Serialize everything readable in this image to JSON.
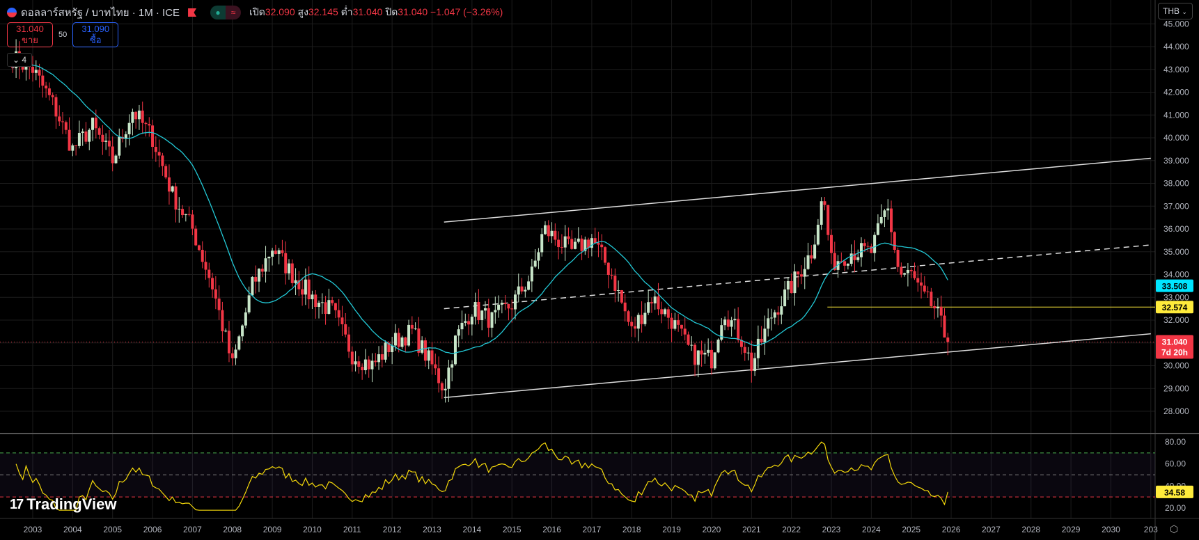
{
  "header": {
    "title": "ดอลลาร์สหรัฐ / บาทไทย · 1M · ICE",
    "open_label": "เปิด",
    "open": "32.090",
    "high_label": "สูง",
    "high": "32.145",
    "low_label": "ต่ำ",
    "low": "31.040",
    "close_label": "ปิด",
    "close": "31.040",
    "change": "−1.047 (−3.26%)",
    "pill_left": "●",
    "pill_right": "≈"
  },
  "trade": {
    "sell_price": "31.040",
    "sell_label": "ขาย",
    "qty": "50",
    "buy_price": "31.090",
    "buy_label": "ซื้อ"
  },
  "collapse_label": "4",
  "currency": "THB",
  "logo": "TradingView",
  "colors": {
    "up": "#c8e6c9",
    "down": "#f23645",
    "ma": "#22c9d6",
    "level": "#ffeb3b",
    "bg": "#000000",
    "grid": "#1c1c1c"
  },
  "chart_data": {
    "type": "candlestick",
    "price_ticks": [
      "45.000",
      "44.000",
      "43.000",
      "42.000",
      "41.000",
      "40.000",
      "39.000",
      "38.000",
      "37.000",
      "36.000",
      "35.000",
      "34.000",
      "33.000",
      "32.000",
      "31.000",
      "30.000",
      "29.000",
      "28.000"
    ],
    "years": [
      "2003",
      "2004",
      "2005",
      "2006",
      "2007",
      "2008",
      "2009",
      "2010",
      "2011",
      "2012",
      "2013",
      "2014",
      "2015",
      "2016",
      "2017",
      "2018",
      "2019",
      "2020",
      "2021",
      "2022",
      "2023",
      "2024",
      "2025",
      "2026",
      "2027",
      "2028",
      "2029",
      "2030",
      "203"
    ],
    "close_anchors": [
      [
        2002.5,
        43.5
      ],
      [
        2003.0,
        43.0
      ],
      [
        2003.5,
        41.5
      ],
      [
        2004.0,
        39.5
      ],
      [
        2004.5,
        40.5
      ],
      [
        2005.0,
        39.0
      ],
      [
        2005.5,
        41.2
      ],
      [
        2006.0,
        40.0
      ],
      [
        2006.5,
        37.5
      ],
      [
        2007.0,
        36.0
      ],
      [
        2007.5,
        33.5
      ],
      [
        2008.0,
        30.0
      ],
      [
        2008.5,
        33.5
      ],
      [
        2009.0,
        35.2
      ],
      [
        2009.5,
        34.0
      ],
      [
        2010.0,
        33.0
      ],
      [
        2010.5,
        32.4
      ],
      [
        2011.0,
        30.5
      ],
      [
        2011.5,
        30.0
      ],
      [
        2012.0,
        31.0
      ],
      [
        2012.5,
        31.5
      ],
      [
        2013.0,
        30.0
      ],
      [
        2013.3,
        29.0
      ],
      [
        2013.6,
        31.2
      ],
      [
        2014.0,
        32.5
      ],
      [
        2014.5,
        32.0
      ],
      [
        2015.0,
        32.7
      ],
      [
        2015.5,
        34.0
      ],
      [
        2015.8,
        36.0
      ],
      [
        2016.5,
        35.0
      ],
      [
        2017.0,
        35.6
      ],
      [
        2017.5,
        34.0
      ],
      [
        2018.0,
        31.5
      ],
      [
        2018.5,
        33.0
      ],
      [
        2019.0,
        32.0
      ],
      [
        2019.5,
        30.5
      ],
      [
        2020.0,
        30.3
      ],
      [
        2020.3,
        32.5
      ],
      [
        2020.8,
        31.0
      ],
      [
        2021.0,
        30.0
      ],
      [
        2021.5,
        32.2
      ],
      [
        2022.0,
        33.5
      ],
      [
        2022.5,
        35.0
      ],
      [
        2022.8,
        37.5
      ],
      [
        2023.0,
        34.5
      ],
      [
        2023.5,
        35.0
      ],
      [
        2024.0,
        35.0
      ],
      [
        2024.4,
        37.0
      ],
      [
        2024.7,
        34.0
      ],
      [
        2025.0,
        34.0
      ],
      [
        2025.3,
        33.0
      ],
      [
        2025.6,
        32.5
      ],
      [
        2025.9,
        31.04
      ]
    ],
    "channel_upper": [
      [
        2013.3,
        36.3
      ],
      [
        2031.0,
        39.1
      ]
    ],
    "channel_mid": [
      [
        2013.3,
        32.5
      ],
      [
        2031.0,
        35.3
      ]
    ],
    "channel_lower": [
      [
        2013.3,
        28.6
      ],
      [
        2031.0,
        31.4
      ]
    ],
    "level_line": {
      "from": 2022.9,
      "price": 32.574,
      "label": "32.574"
    },
    "ma_label": "33.508",
    "last_price": "31.040",
    "countdown": "7d 20h",
    "rsi": {
      "ticks": [
        "80.00",
        "60.00",
        "40.00",
        "20.00"
      ],
      "upper": 70,
      "mid": 50,
      "lower": 30,
      "value": "34.58"
    }
  }
}
